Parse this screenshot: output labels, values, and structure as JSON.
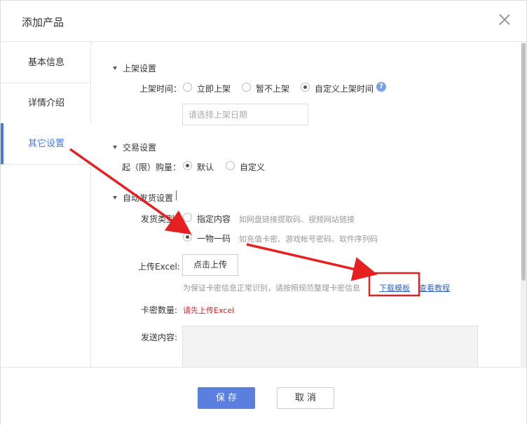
{
  "dialog": {
    "title": "添加产品"
  },
  "sidebar": {
    "items": [
      {
        "label": "基本信息"
      },
      {
        "label": "详情介绍"
      },
      {
        "label": "其它设置"
      }
    ]
  },
  "sections": {
    "listing": {
      "title": "上架设置",
      "time_label": "上架时间：",
      "options": [
        "立即上架",
        "暂不上架",
        "自定义上架时间"
      ],
      "selected": "自定义上架时间",
      "date_placeholder": "请选择上架日期"
    },
    "trade": {
      "title": "交易设置",
      "min_qty_label": "起（限）购量：",
      "options": [
        "默认",
        "自定义"
      ],
      "selected": "默认"
    },
    "delivery": {
      "title": "自动发货设置",
      "type_label": "发货类型：",
      "options": [
        {
          "label": "指定内容",
          "hint": "如网盘链接提取码、视频网站链接"
        },
        {
          "label": "一物一码",
          "hint": "如充值卡密、游戏帐号密码、软件序列码"
        }
      ],
      "selected": "一物一码",
      "upload_label": "上传Excel:",
      "upload_button": "点击上传",
      "upload_hint": "为保证卡密信息正常识别，请按照规范整理卡密信息",
      "download_template": "下载模板",
      "view_tutorial": "查看教程",
      "card_count_label": "卡密数量:",
      "card_count_value": "请先上传Excel",
      "send_content_label": "发送内容:"
    }
  },
  "footer": {
    "save": "保 存",
    "cancel": "取 消"
  },
  "colors": {
    "accent": "#5b7fde",
    "annotation": "#e52020",
    "link": "#3366cc",
    "error": "#e02020"
  }
}
